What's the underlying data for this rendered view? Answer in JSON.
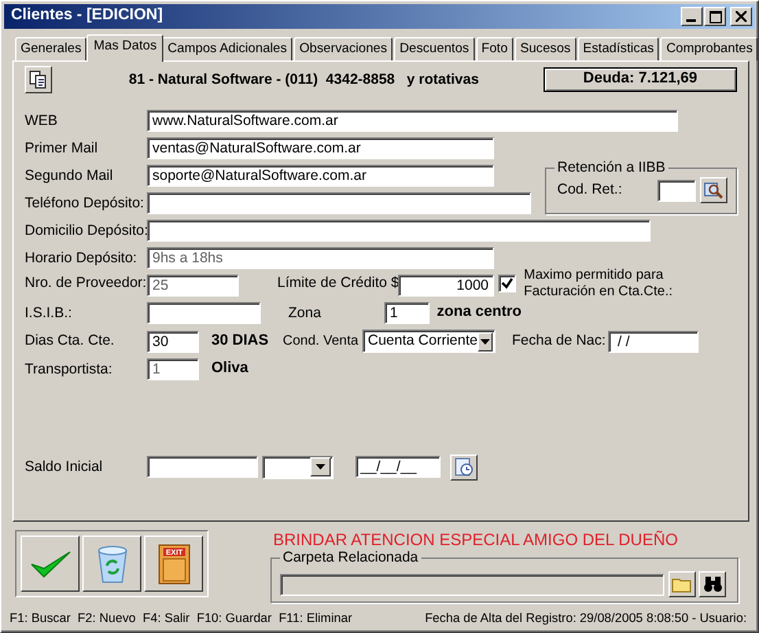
{
  "window": {
    "title": "Clientes - [EDICION]"
  },
  "tabs": [
    {
      "label": "Generales",
      "selected": false
    },
    {
      "label": "Mas Datos",
      "selected": true
    },
    {
      "label": "Campos Adicionales",
      "selected": false
    },
    {
      "label": "Observaciones",
      "selected": false
    },
    {
      "label": "Descuentos",
      "selected": false
    },
    {
      "label": "Foto",
      "selected": false
    },
    {
      "label": "Sucesos",
      "selected": false
    },
    {
      "label": "Estadísticas",
      "selected": false
    },
    {
      "label": "Comprobantes",
      "selected": false
    }
  ],
  "header": {
    "client": "81 - Natural Software - (011)  4342-8858   y rotativas",
    "debt": "Deuda: 7.121,69"
  },
  "fields": {
    "web": {
      "label": "WEB",
      "value": "www.NaturalSoftware.com.ar"
    },
    "mail1": {
      "label": "Primer Mail",
      "value": "ventas@NaturalSoftware.com.ar"
    },
    "mail2": {
      "label": "Segundo Mail",
      "value": "soporte@NaturalSoftware.com.ar"
    },
    "phone": {
      "label": "Teléfono Depósito:"
    },
    "address": {
      "label": "Domicilio Depósito:"
    },
    "hours": {
      "label": "Horario Depósito:",
      "value": "9hs a 18hs"
    },
    "supplier": {
      "label": "Nro. de Proveedor:",
      "value": "25"
    },
    "credit": {
      "label": "Límite de Crédito $",
      "value": "1000"
    },
    "max_allowed": {
      "label": "Maximo permitido para Facturación en Cta.Cte.:",
      "checked": true
    },
    "isib": {
      "label": "I.S.I.B.:"
    },
    "zone": {
      "label": "Zona",
      "value": "1",
      "description": "zona centro"
    },
    "days": {
      "label": "Dias Cta. Cte.",
      "value": "30",
      "description": "30 DIAS"
    },
    "sale": {
      "label": "Cond. Venta",
      "value": "Cuenta Corriente"
    },
    "birth": {
      "label": "Fecha de Nac:",
      "value": "/ /"
    },
    "carrier": {
      "label": "Transportista:",
      "value": "1",
      "description": "Oliva"
    },
    "balance": {
      "label": "Saldo Inicial",
      "date": "__/__/__"
    }
  },
  "retention": {
    "title": "Retención a IIBB",
    "label": "Cod. Ret.:"
  },
  "exit_icon_text": "EXIT",
  "notice": "BRINDAR ATENCION ESPECIAL AMIGO DEL DUEÑO",
  "folder": {
    "title": "Carpeta Relacionada"
  },
  "status_bar": {
    "keys": "F1: Buscar  F2: Nuevo  F4: Salir  F10: Guardar  F11: Eliminar",
    "created": "Fecha de Alta del Registro: 29/08/2005 8:08:50 - Usuario:"
  }
}
